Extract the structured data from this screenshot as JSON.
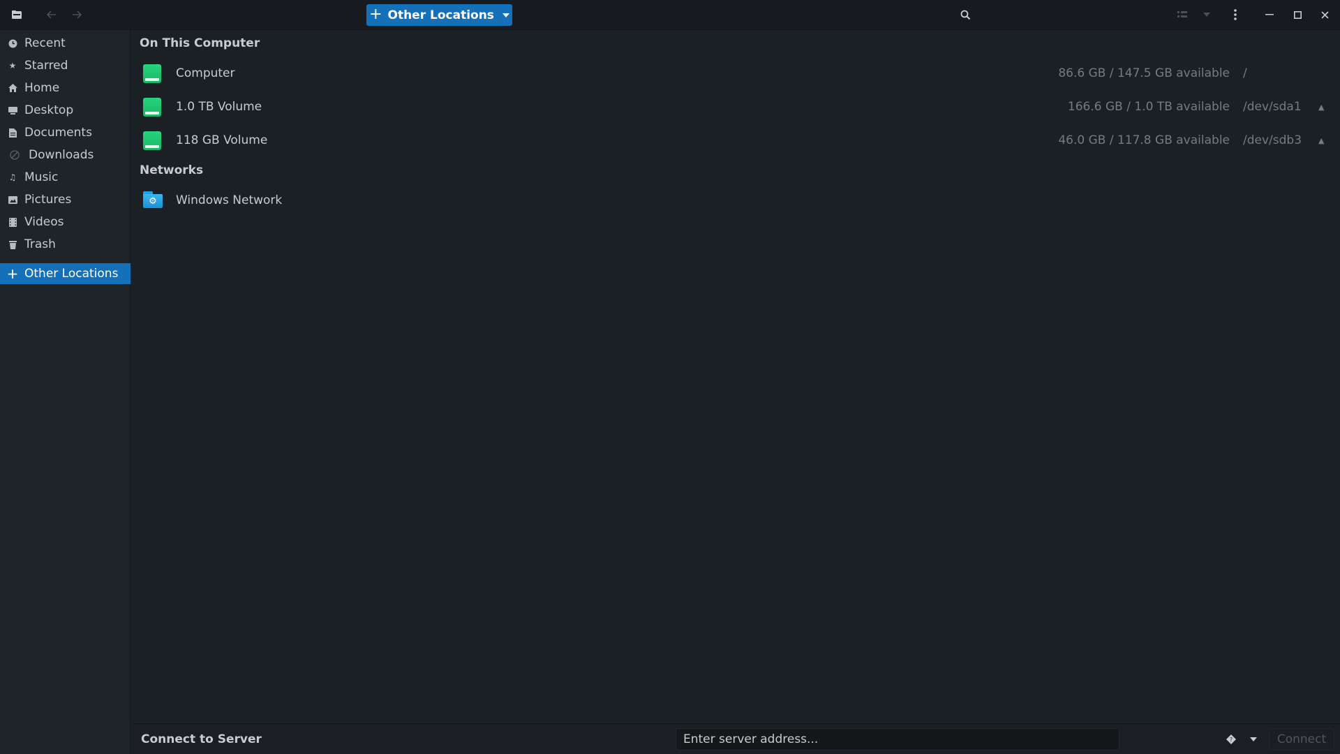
{
  "header": {
    "app_icon": "file-manager-icon",
    "back_icon": "back-arrow-icon",
    "forward_icon": "forward-arrow-icon",
    "path_button_label": "Other Locations",
    "search_icon": "search-icon",
    "view_toggle_icon": "list-view-icon",
    "view_options_icon": "chevron-down-icon",
    "menu_icon": "vertical-dots-icon",
    "window_controls": [
      "minimize",
      "maximize",
      "close"
    ]
  },
  "sidebar": {
    "items": [
      {
        "label": "Recent",
        "icon": "clock-icon"
      },
      {
        "label": "Starred",
        "icon": "star-icon"
      },
      {
        "label": "Home",
        "icon": "home-icon"
      },
      {
        "label": "Desktop",
        "icon": "desktop-icon"
      },
      {
        "label": "Documents",
        "icon": "document-icon"
      },
      {
        "label": "Downloads",
        "icon": "download-icon"
      },
      {
        "label": "Music",
        "icon": "music-icon"
      },
      {
        "label": "Pictures",
        "icon": "picture-icon"
      },
      {
        "label": "Videos",
        "icon": "video-icon"
      },
      {
        "label": "Trash",
        "icon": "trash-icon"
      }
    ],
    "active": {
      "label": "Other Locations",
      "icon": "plus-icon"
    }
  },
  "main": {
    "on_this_computer_title": "On This Computer",
    "locations": [
      {
        "name": "Computer",
        "available": "86.6 GB / 147.5 GB available",
        "device": "/",
        "ejectable": false
      },
      {
        "name": "1.0 TB Volume",
        "available": "166.6 GB / 1.0 TB available",
        "device": "/dev/sda1",
        "ejectable": true
      },
      {
        "name": "118 GB Volume",
        "available": "46.0 GB / 117.8 GB available",
        "device": "/dev/sdb3",
        "ejectable": true
      }
    ],
    "networks_title": "Networks",
    "networks": [
      {
        "name": "Windows Network"
      }
    ]
  },
  "bottom": {
    "connect_label": "Connect to Server",
    "server_placeholder": "Enter server address...",
    "connect_button": "Connect"
  },
  "colors": {
    "accent": "#1470b8",
    "background": "#1b2024",
    "sidebar": "#1f2428",
    "drive_green": "#1ec773",
    "network_blue": "#2aa8ea"
  }
}
